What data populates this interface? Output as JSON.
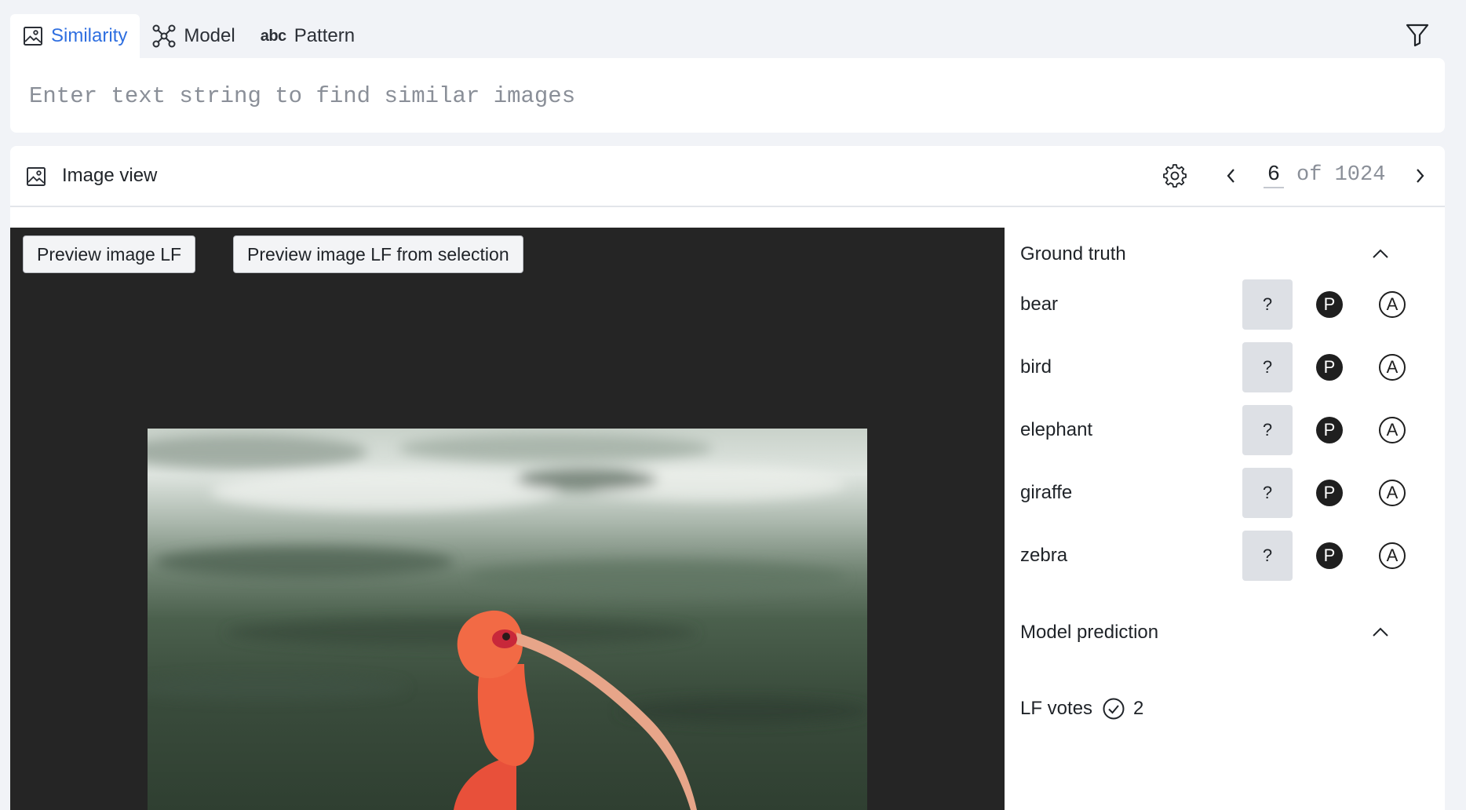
{
  "tabs": [
    {
      "label": "Similarity",
      "icon": "image-icon",
      "active": true
    },
    {
      "label": "Model",
      "icon": "network-icon",
      "active": false
    },
    {
      "label": "Pattern",
      "icon_text": "abc",
      "active": false
    }
  ],
  "search": {
    "placeholder": "Enter text string to find similar images",
    "value": ""
  },
  "image_view": {
    "title": "Image view",
    "current_page": "6",
    "page_of": "of 1024",
    "preview_button": "Preview image LF",
    "preview_selection_button": "Preview image LF from selection"
  },
  "ground_truth": {
    "heading": "Ground truth",
    "labels": [
      {
        "name": "bear",
        "unknown": "?",
        "positive": "P",
        "absent": "A"
      },
      {
        "name": "bird",
        "unknown": "?",
        "positive": "P",
        "absent": "A"
      },
      {
        "name": "elephant",
        "unknown": "?",
        "positive": "P",
        "absent": "A"
      },
      {
        "name": "giraffe",
        "unknown": "?",
        "positive": "P",
        "absent": "A"
      },
      {
        "name": "zebra",
        "unknown": "?",
        "positive": "P",
        "absent": "A"
      }
    ]
  },
  "model_prediction": {
    "heading": "Model prediction"
  },
  "lf_votes": {
    "label": "LF votes",
    "count": "2"
  },
  "colors": {
    "accent": "#2f6fe0",
    "background": "#f1f3f7",
    "image_background": "#252525"
  }
}
